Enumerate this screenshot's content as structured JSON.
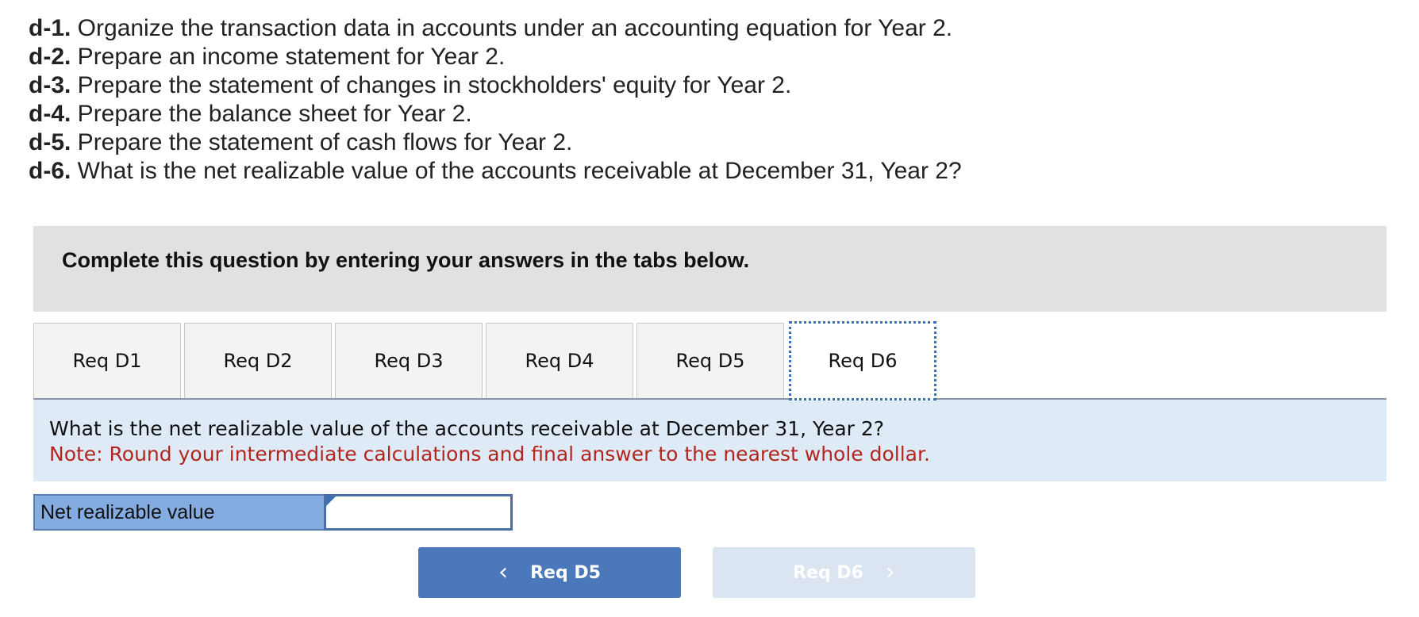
{
  "requirements": [
    {
      "id": "d-1.",
      "text": " Organize the transaction data in accounts under an accounting equation for Year 2."
    },
    {
      "id": "d-2.",
      "text": " Prepare an income statement for Year 2."
    },
    {
      "id": "d-3.",
      "text": " Prepare the statement of changes in stockholders' equity for Year 2."
    },
    {
      "id": "d-4.",
      "text": " Prepare the balance sheet for Year 2."
    },
    {
      "id": "d-5.",
      "text": " Prepare the statement of cash flows for Year 2."
    },
    {
      "id": "d-6.",
      "text": " What is the net realizable value of the accounts receivable at December 31, Year 2?"
    }
  ],
  "instruction": "Complete this question by entering your answers in the tabs below.",
  "tabs": [
    {
      "label": "Req D1",
      "active": false
    },
    {
      "label": "Req D2",
      "active": false
    },
    {
      "label": "Req D3",
      "active": false
    },
    {
      "label": "Req D4",
      "active": false
    },
    {
      "label": "Req D5",
      "active": false
    },
    {
      "label": "Req D6",
      "active": true
    }
  ],
  "question": {
    "text": "What is the net realizable value of the accounts receivable at December 31, Year 2?",
    "note": "Note: Round your intermediate calculations and final answer to the nearest whole dollar."
  },
  "answer": {
    "label": "Net realizable value",
    "value": ""
  },
  "navigation": {
    "prev_label": "Req D5",
    "next_label": "Req D6",
    "prev_icon": "chevron-left-icon",
    "next_icon": "chevron-right-icon",
    "next_disabled": true
  },
  "colors": {
    "accent": "#4a78bb",
    "note": "#b3261e",
    "panel": "#dfeaf7",
    "label_bg": "#85ace0"
  }
}
